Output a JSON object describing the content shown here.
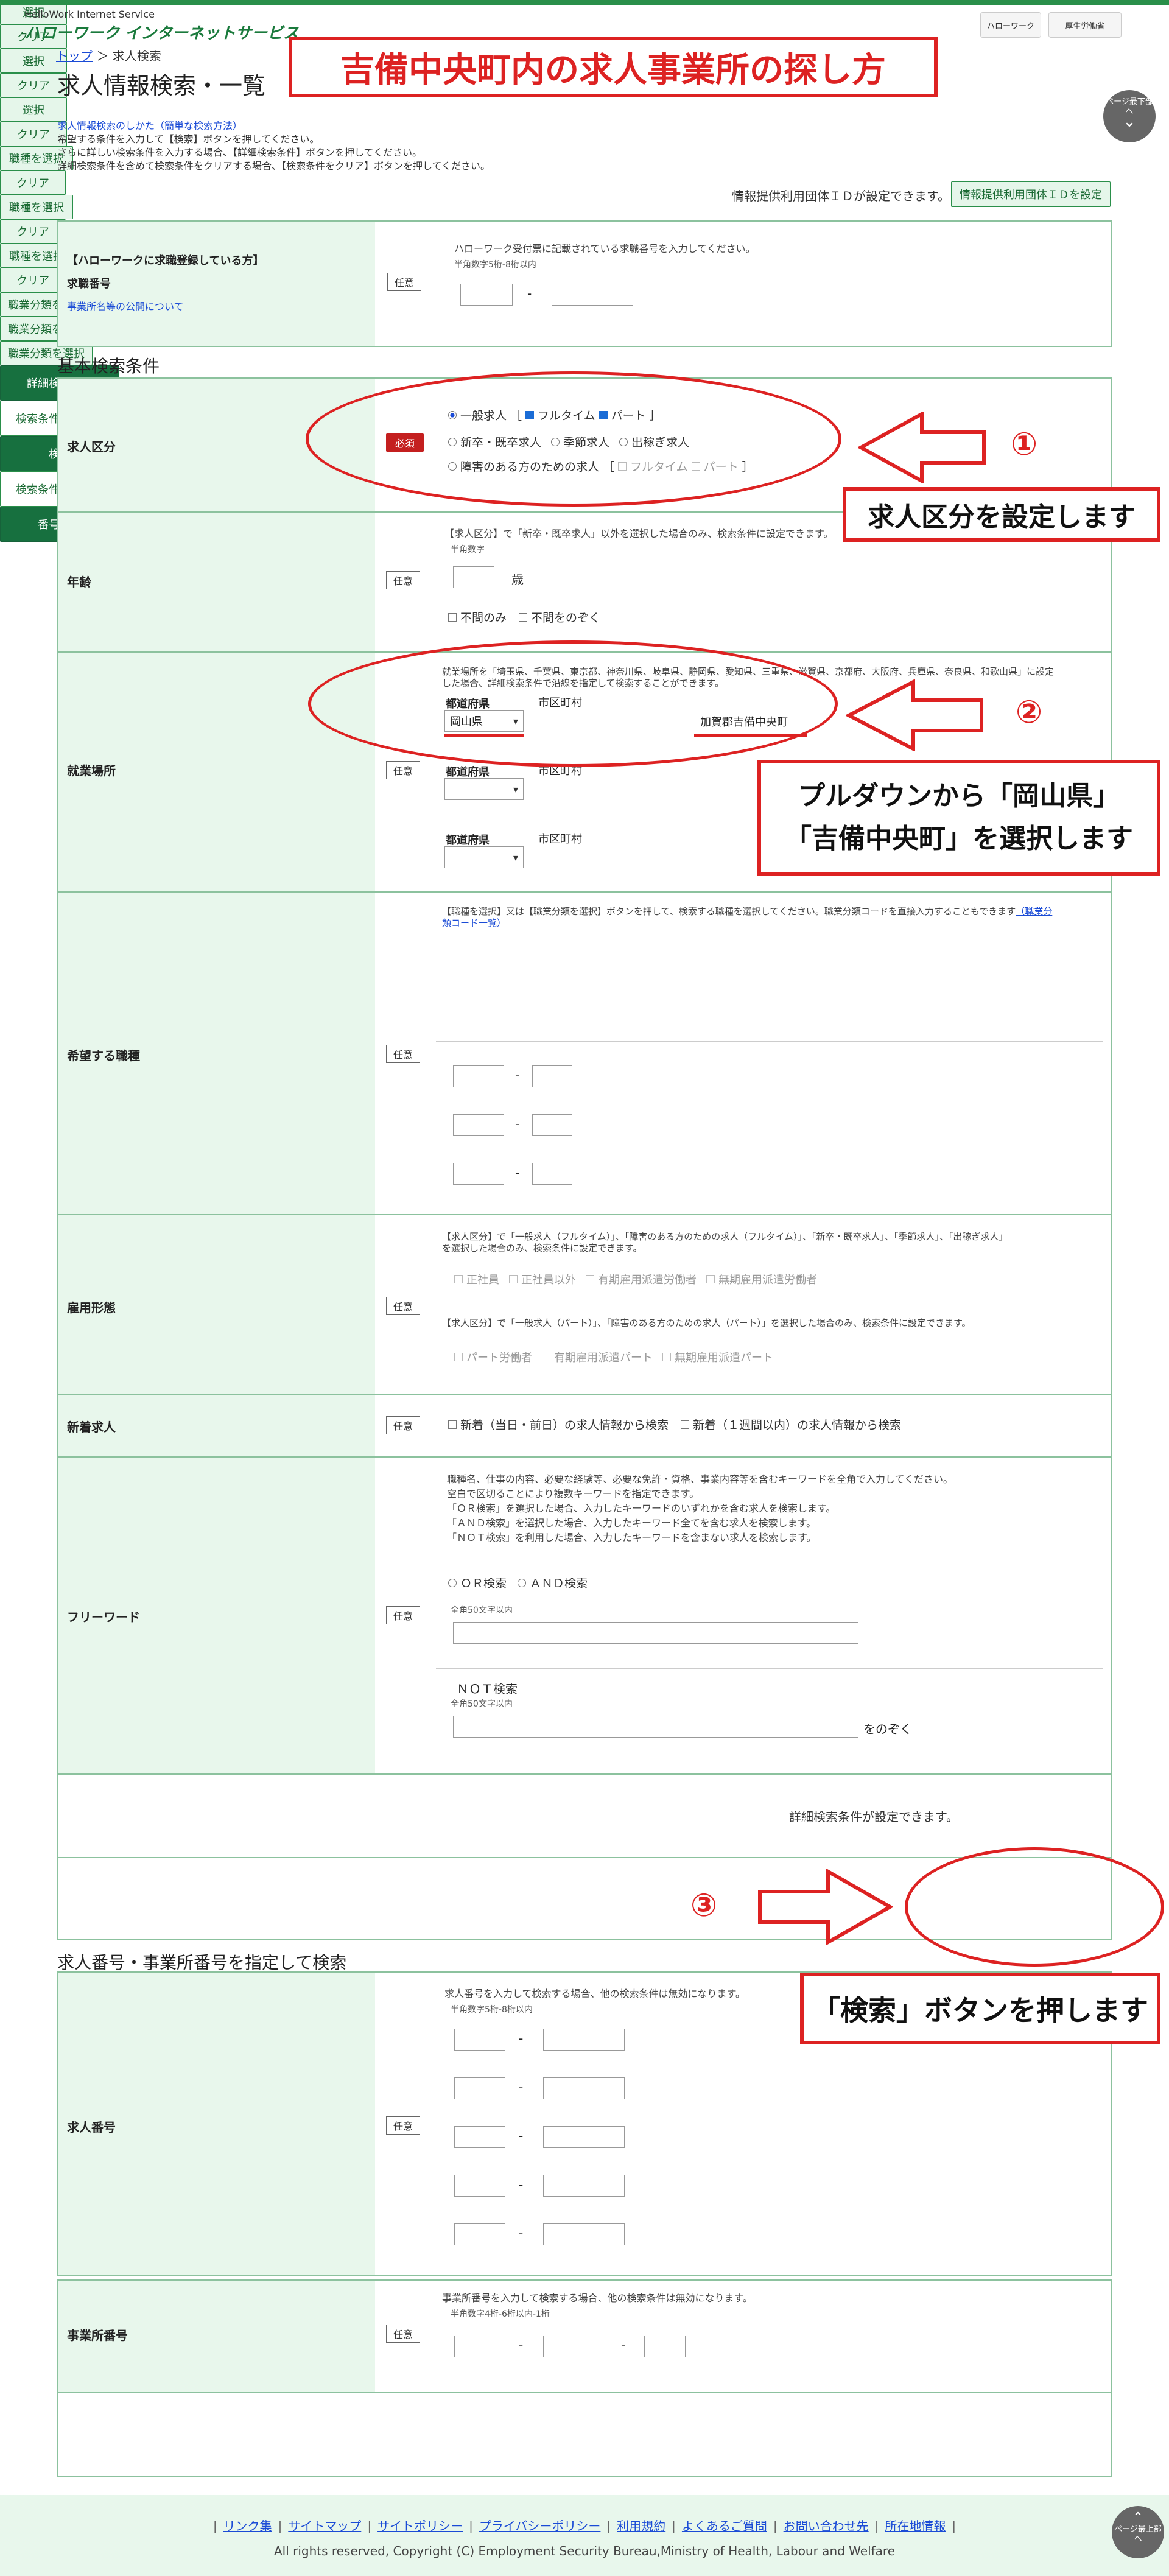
{
  "header": {
    "service_en": "HelloWork Internet Service",
    "logo": "ハローワーク インターネットサービス",
    "right_badge1": "ハローワーク",
    "right_badge2": "厚生労働省"
  },
  "breadcrumb": {
    "top": "トップ",
    "sep": " ＞ ",
    "current": "求人検索"
  },
  "page_title": "求人情報検索・一覧",
  "overlay_title": "吉備中央町内の求人事業所の探し方",
  "page_bottom_btn": "ページ最下部へ",
  "page_top_btn": "ページ最上部へ",
  "intro": {
    "link": "求人情報検索のしかた（簡単な検索方法）",
    "l1": "希望する条件を入力して【検索】ボタンを押してください。",
    "l2": "さらに詳しい検索条件を入力する場合、【詳細検索条件】ボタンを押してください。",
    "l3": "詳細検索条件を含めて検索条件をクリアする場合、【検索条件をクリア】ボタンを押してください。"
  },
  "info_provider": {
    "text": "情報提供利用団体ＩＤが設定できます。",
    "button": "情報提供利用団体ＩＤを設定"
  },
  "registered": {
    "label": "【ハローワークに求職登録している方】",
    "sub": "求職番号",
    "link": "事業所名等の公開について",
    "tag": "任意",
    "note": "ハローワーク受付票に記載されている求職番号を入力してください。",
    "format": "半角数字5桁-8桁以内",
    "dash": "-"
  },
  "basic_heading": "基本検索条件",
  "kyujin_kubun": {
    "label": "求人区分",
    "tag": "必須",
    "general": "一般求人",
    "bracket_open": "［",
    "bracket_close": "］",
    "fulltime": "フルタイム",
    "part": "パート",
    "new_grad": "新卒・既卒求人",
    "seasonal": "季節求人",
    "dekasegi": "出稼ぎ求人",
    "disabled": "障害のある方のための求人",
    "d_fulltime": "フルタイム",
    "d_part": "パート"
  },
  "age": {
    "label": "年齢",
    "tag": "任意",
    "note": "【求人区分】で「新卒・既卒求人」以外を選択した場合のみ、検索条件に設定できます。",
    "format": "半角数字",
    "unit": "歳",
    "opt1": "不問のみ",
    "opt2": "不問をのぞく"
  },
  "workplace": {
    "label": "就業場所",
    "tag": "任意",
    "note1": "就業場所を「埼玉県、千葉県、東京都、神奈川県、岐阜県、静岡県、愛知県、三重県、滋賀県、京都府、大阪府、兵庫県、奈良県、和歌山県」に設定",
    "note2": "した場合、詳細検索条件で沿線を指定して検索することができます。",
    "pref_label": "都道府県",
    "city_label": "市区町村",
    "pref_value": "岡山県",
    "city_value": "加賀郡吉備中央町",
    "select": "選択",
    "clear": "クリア"
  },
  "job": {
    "label": "希望する職種",
    "tag": "任意",
    "note1": "【職種を選択】又は【職業分類を選択】ボタンを押して、検索する職種を選択してください。職業分類コードを直接入力することもできます",
    "note_link1": "（職業分",
    "note_link2": "類コード一覧）",
    "select_job": "職種を選択",
    "clear": "クリア",
    "select_class": "職業分類を選択",
    "dash": "-"
  },
  "employment": {
    "label": "雇用形態",
    "tag": "任意",
    "note1": "【求人区分】で「一般求人（フルタイム）」、「障害のある方のための求人（フルタイム）」、「新卒・既卒求人」、「季節求人」、「出稼ぎ求人」",
    "note1b": "を選択した場合のみ、検索条件に設定できます。",
    "o1": "正社員",
    "o2": "正社員以外",
    "o3": "有期雇用派遣労働者",
    "o4": "無期雇用派遣労働者",
    "note2": "【求人区分】で「一般求人（パート）」、「障害のある方のための求人（パート）」を選択した場合のみ、検索条件に設定できます。",
    "p1": "パート労働者",
    "p2": "有期雇用派遣パート",
    "p3": "無期雇用派遣パート"
  },
  "new_listing": {
    "label": "新着求人",
    "tag": "任意",
    "o1": "新着（当日・前日）の求人情報から検索",
    "o2": "新着（１週間以内）の求人情報から検索"
  },
  "freeword": {
    "label": "フリーワード",
    "tag": "任意",
    "n1": "職種名、仕事の内容、必要な経験等、必要な免許・資格、事業内容等を含むキーワードを全角で入力してください。",
    "n2": "空白で区切ることにより複数キーワードを指定できます。",
    "n3": "「ＯＲ検索」を選択した場合、入力したキーワードのいずれかを含む求人を検索します。",
    "n4": "「ＡＮＤ検索」を選択した場合、入力したキーワード全てを含む求人を検索します。",
    "n5": "「ＮＯＴ検索」を利用した場合、入力したキーワードを含まない求人を検索します。",
    "or": "ＯＲ検索",
    "and": "ＡＮＤ検索",
    "limit": "全角50文字以内",
    "not_label": "ＮＯＴ検索",
    "exclude": "をのぞく"
  },
  "detail": {
    "text": "詳細検索条件が設定できます。",
    "button": "詳細検索条件"
  },
  "actions": {
    "clear": "検索条件をクリア",
    "search": "検索"
  },
  "number_heading": "求人番号・事業所番号を指定して検索",
  "job_number": {
    "label": "求人番号",
    "tag": "任意",
    "note": "求人番号を入力して検索する場合、他の検索条件は無効になります。",
    "format": "半角数字5桁-8桁以内",
    "dash": "-"
  },
  "office_number": {
    "label": "事業所番号",
    "tag": "任意",
    "note": "事業所番号を入力して検索する場合、他の検索条件は無効になります。",
    "format": "半角数字4桁-6桁以内-1桁",
    "dash": "-"
  },
  "number_actions": {
    "clear": "検索条件をクリア",
    "search": "番号検索"
  },
  "annotations": {
    "n1": "①",
    "n2": "②",
    "n3": "③",
    "t1": "求人区分を設定します",
    "t2a": "プルダウンから「岡山県」",
    "t2b": "「吉備中央町」を選択します",
    "t3": "「検索」ボタンを押します"
  },
  "footer": {
    "links": [
      "リンク集",
      "サイトマップ",
      "サイトポリシー",
      "プライバシーポリシー",
      "利用規約",
      "よくあるご質問",
      "お問い合わせ先",
      "所在地情報"
    ],
    "sep": "|",
    "copyright": "All rights reserved, Copyright (C) Employment Security Bureau,Ministry of Health, Labour and Welfare"
  },
  "colors": {
    "accent": "#17703f",
    "label_bg": "#e8f7ec",
    "annotation": "#dd2222"
  }
}
